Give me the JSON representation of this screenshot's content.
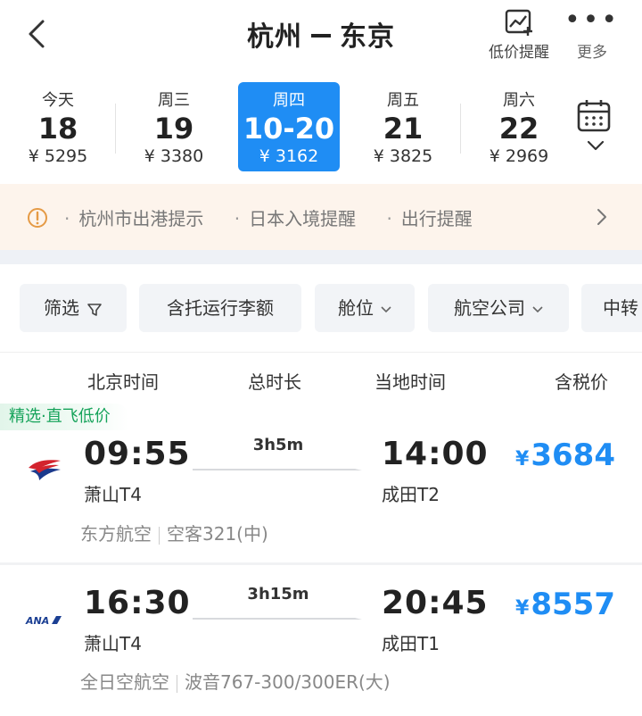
{
  "header": {
    "origin": "杭州",
    "destination": "东京",
    "low_price_alert_label": "低价提醒",
    "more_label": "更多"
  },
  "dates": [
    {
      "weekday": "今天",
      "date": "18",
      "price": "¥ 5295",
      "selected": false
    },
    {
      "weekday": "周三",
      "date": "19",
      "price": "¥ 3380",
      "selected": false
    },
    {
      "weekday": "周四",
      "date": "10-20",
      "price": "¥ 3162",
      "selected": true
    },
    {
      "weekday": "周五",
      "date": "21",
      "price": "¥ 3825",
      "selected": false
    },
    {
      "weekday": "周六",
      "date": "22",
      "price": "¥ 2969",
      "selected": false
    }
  ],
  "notice": {
    "items": [
      "杭州市出港提示",
      "日本入境提醒",
      "出行提醒"
    ]
  },
  "filters": [
    {
      "label": "筛选",
      "icon": "funnel-icon"
    },
    {
      "label": "含托运行李额"
    },
    {
      "label": "舱位",
      "icon": "chevron-down-icon"
    },
    {
      "label": "航空公司",
      "icon": "chevron-down-icon"
    },
    {
      "label": "中转"
    }
  ],
  "columns": [
    "北京时间",
    "总时长",
    "当地时间",
    "含税价"
  ],
  "flights": [
    {
      "badge": "精选·直飞低价",
      "airline_logo": "china-eastern-logo",
      "dep_time": "09:55",
      "dep_airport": "萧山T4",
      "duration": "3h5m",
      "arr_time": "14:00",
      "arr_airport": "成田T2",
      "price_symbol": "¥",
      "price": "3684",
      "airline": "东方航空",
      "aircraft": "空客321(中)"
    },
    {
      "airline_logo": "ana-logo",
      "logo_text": "ANA",
      "dep_time": "16:30",
      "dep_airport": "萧山T4",
      "duration": "3h15m",
      "arr_time": "20:45",
      "arr_airport": "成田T1",
      "price_symbol": "¥",
      "price": "8557",
      "airline": "全日空航空",
      "aircraft": "波音767-300/300ER(大)"
    }
  ],
  "colors": {
    "accent_blue": "#1f8df4",
    "badge_green": "#16a35a",
    "notice_bg": "#fdf4ec",
    "eastern_red": "#d3232d",
    "eastern_blue": "#1b3a8c",
    "ana_blue": "#1b3f93"
  }
}
